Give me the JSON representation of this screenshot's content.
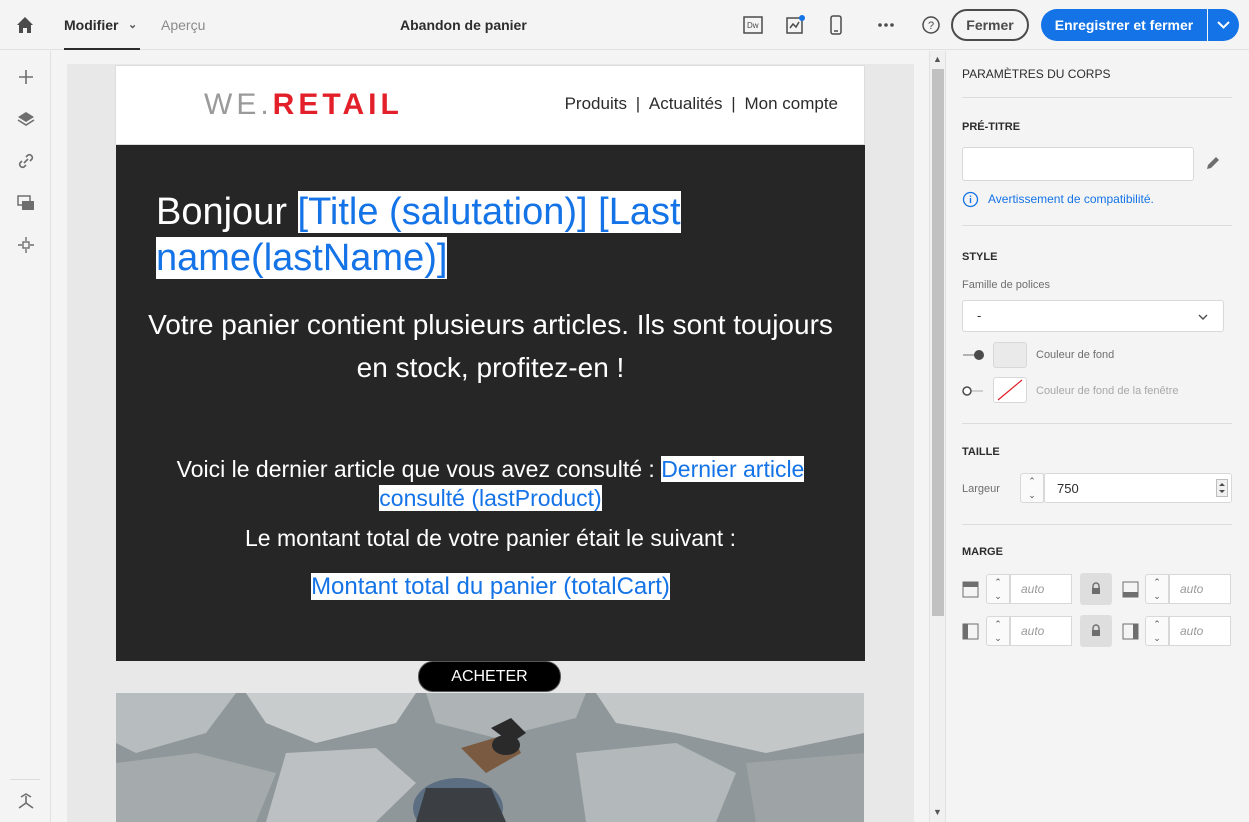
{
  "topbar": {
    "tab_modifier": "Modifier",
    "tab_apercu": "Aperçu",
    "title": "Abandon de panier",
    "dw_label": "Dw",
    "fermer": "Fermer",
    "save": "Enregistrer et fermer",
    "accent": "#1473e6"
  },
  "email": {
    "logo_we": "WE.",
    "logo_retail": "RETAIL",
    "nav": [
      "Produits",
      "|",
      "Actualités",
      "|",
      "Mon compte"
    ],
    "hello_prefix": "Bonjour ",
    "hello_pers": "[Title (salutation)] [Last name(lastName)]",
    "intro": "Votre panier contient plusieurs articles. Ils sont toujours en stock, profitez-en !",
    "line1_text": "Voici le dernier article que vous avez consulté : ",
    "line1_pers": "Dernier article consulté (lastProduct)",
    "line2": "Le montant total de votre panier était le suivant :",
    "line3_pers": "Montant total du panier (totalCart)",
    "button": "ACHETER",
    "brand_red": "#e32029"
  },
  "panel": {
    "title": "PARAMÈTRES DU CORPS",
    "pretitle": "PRÉ-TITRE",
    "pretitle_value": "",
    "compat": "Avertissement de compatibilité.",
    "style": "STYLE",
    "font_family_label": "Famille de polices",
    "font_family_value": "-",
    "bg_color": "Couleur de fond",
    "window_bg": "Couleur de fond de la fenêtre",
    "size": "TAILLE",
    "width_label": "Largeur",
    "width_value": "750",
    "margin": "MARGE",
    "margin_placeholder": "auto"
  },
  "icons": [
    "home-icon",
    "chevron-down-icon",
    "dreamweaver-icon",
    "test-icon",
    "mobile-icon",
    "more-icon",
    "help-icon",
    "add-icon",
    "layers-icon",
    "link-icon",
    "assets-icon",
    "structure-icon",
    "edit-icon",
    "info-icon",
    "lock-icon"
  ]
}
